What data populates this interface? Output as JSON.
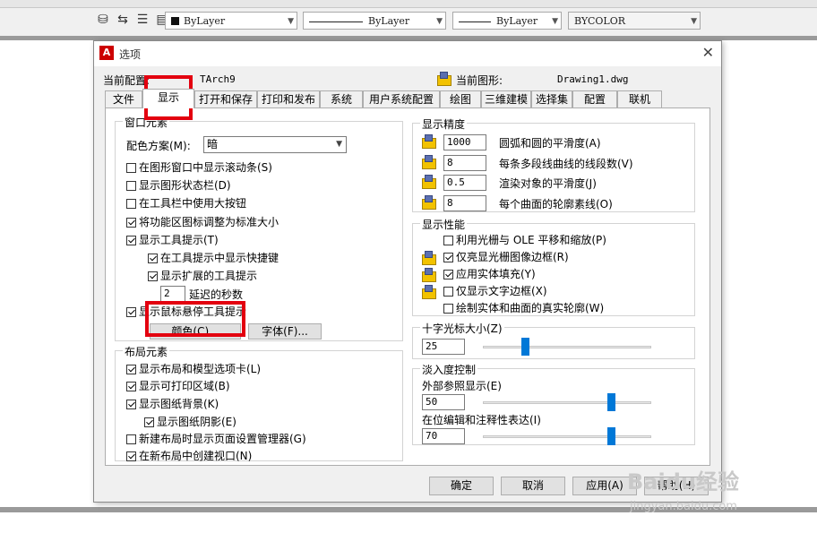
{
  "toolbar": {
    "layer_color": "ByLayer",
    "layer_linetype": "ByLayer",
    "layer_lineweight": "ByLayer",
    "plot_style": "BYCOLOR"
  },
  "dialog": {
    "title": "选项",
    "current_profile_label": "当前配置:",
    "current_profile_value": "TArch9",
    "current_drawing_label": "当前图形:",
    "current_drawing_value": "Drawing1.dwg",
    "tabs": [
      "文件",
      "显示",
      "打开和保存",
      "打印和发布",
      "系统",
      "用户系统配置",
      "绘图",
      "三维建模",
      "选择集",
      "配置",
      "联机"
    ],
    "active_tab": "显示"
  },
  "window_elements": {
    "title": "窗口元素",
    "color_scheme_label": "配色方案(M):",
    "color_scheme_value": "暗",
    "checks": [
      {
        "label": "在图形窗口中显示滚动条(S)",
        "checked": false
      },
      {
        "label": "显示图形状态栏(D)",
        "checked": false
      },
      {
        "label": "在工具栏中使用大按钮",
        "checked": false
      },
      {
        "label": "将功能区图标调整为标准大小",
        "checked": true
      },
      {
        "label": "显示工具提示(T)",
        "checked": true
      },
      {
        "label": "在工具提示中显示快捷键",
        "checked": true
      },
      {
        "label": "显示扩展的工具提示",
        "checked": true
      },
      {
        "label": "显示鼠标悬停工具提示",
        "checked": true
      }
    ],
    "delay_value": "2",
    "delay_label": "延迟的秒数",
    "colors_button": "颜色(C)...",
    "fonts_button": "字体(F)..."
  },
  "layout_elements": {
    "title": "布局元素",
    "checks": [
      {
        "label": "显示布局和模型选项卡(L)",
        "checked": true
      },
      {
        "label": "显示可打印区域(B)",
        "checked": true
      },
      {
        "label": "显示图纸背景(K)",
        "checked": true
      },
      {
        "label": "显示图纸阴影(E)",
        "checked": true
      },
      {
        "label": "新建布局时显示页面设置管理器(G)",
        "checked": false
      },
      {
        "label": "在新布局中创建视口(N)",
        "checked": true
      }
    ]
  },
  "display_resolution": {
    "title": "显示精度",
    "rows": [
      {
        "value": "1000",
        "label": "圆弧和圆的平滑度(A)"
      },
      {
        "value": "8",
        "label": "每条多段线曲线的线段数(V)"
      },
      {
        "value": "0.5",
        "label": "渲染对象的平滑度(J)"
      },
      {
        "value": "8",
        "label": "每个曲面的轮廓素线(O)"
      }
    ]
  },
  "display_performance": {
    "title": "显示性能",
    "checks": [
      {
        "label": "利用光栅与 OLE 平移和缩放(P)",
        "checked": false
      },
      {
        "label": "仅亮显光栅图像边框(R)",
        "checked": true
      },
      {
        "label": "应用实体填充(Y)",
        "checked": true
      },
      {
        "label": "仅显示文字边框(X)",
        "checked": false
      },
      {
        "label": "绘制实体和曲面的真实轮廓(W)",
        "checked": false
      }
    ]
  },
  "crosshair": {
    "title": "十字光标大小(Z)",
    "value": "25",
    "slider_fraction": 0.25
  },
  "fade_control": {
    "title": "淡入度控制",
    "xref_label": "外部参照显示(E)",
    "xref_value": "50",
    "xref_fraction": 0.76,
    "inplace_label": "在位编辑和注释性表达(I)",
    "inplace_value": "70",
    "inplace_fraction": 0.76
  },
  "buttons": {
    "ok": "确定",
    "cancel": "取消",
    "apply": "应用(A)",
    "help": "帮助(H)"
  },
  "watermark": {
    "brand": "Baidu经验",
    "url": "jingyan.baidu.com"
  },
  "colors": {
    "highlight_red": "#e3000f",
    "slider_blue": "#0078d7"
  }
}
